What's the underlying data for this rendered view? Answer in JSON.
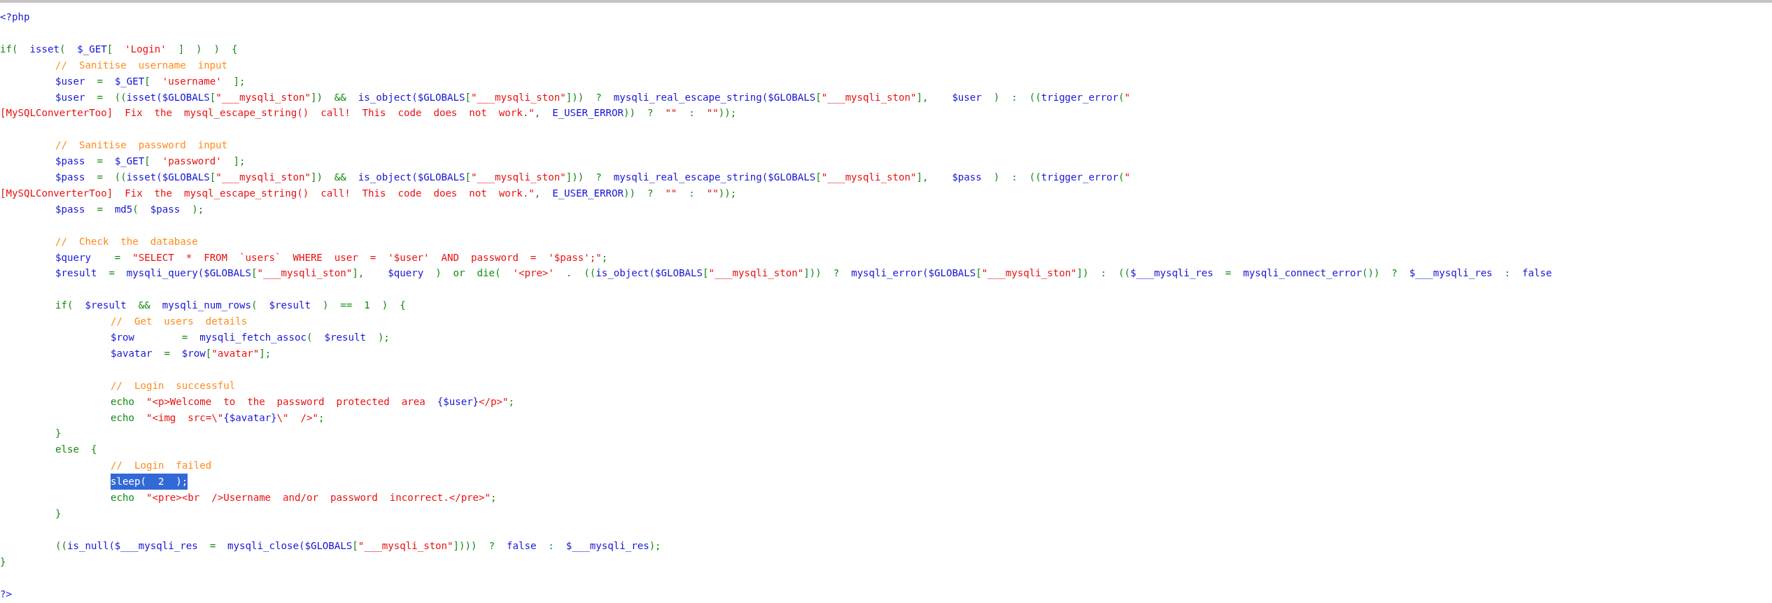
{
  "code_lines": [
    {
      "kind": "code",
      "selected": false,
      "tokens": [
        {
          "text": "<?php",
          "kind": "identifier"
        }
      ]
    },
    {
      "kind": "blank"
    },
    {
      "kind": "code",
      "selected": false,
      "tokens": [
        {
          "text": "if(  ",
          "kind": "operator"
        },
        {
          "text": "isset",
          "kind": "identifier"
        },
        {
          "text": "(  ",
          "kind": "operator"
        },
        {
          "text": "$_GET",
          "kind": "identifier"
        },
        {
          "text": "[  ",
          "kind": "operator"
        },
        {
          "text": "'Login'",
          "kind": "string"
        },
        {
          "text": "  ]  )  )  {",
          "kind": "operator"
        }
      ],
      "children": [
        {
          "kind": "code",
          "selected": false,
          "tokens": [
            {
              "text": "//  Sanitise  username  input",
              "kind": "comment"
            }
          ]
        },
        {
          "kind": "code",
          "selected": false,
          "tokens": [
            {
              "text": "$user  ",
              "kind": "identifier"
            },
            {
              "text": "=  ",
              "kind": "operator"
            },
            {
              "text": "$_GET",
              "kind": "identifier"
            },
            {
              "text": "[  ",
              "kind": "operator"
            },
            {
              "text": "'username'",
              "kind": "string"
            },
            {
              "text": "  ];",
              "kind": "operator"
            }
          ]
        },
        {
          "kind": "code",
          "selected": false,
          "tokens": [
            {
              "text": "$user  ",
              "kind": "identifier"
            },
            {
              "text": "=  ((",
              "kind": "operator"
            },
            {
              "text": "isset($GLOBALS",
              "kind": "identifier"
            },
            {
              "text": "[",
              "kind": "operator"
            },
            {
              "text": "\"___mysqli_ston\"",
              "kind": "string"
            },
            {
              "text": "])  &&  ",
              "kind": "operator"
            },
            {
              "text": "is_object($GLOBALS",
              "kind": "identifier"
            },
            {
              "text": "[",
              "kind": "operator"
            },
            {
              "text": "\"___mysqli_ston\"",
              "kind": "string"
            },
            {
              "text": "]))  ?  ",
              "kind": "operator"
            },
            {
              "text": "mysqli_real_escape_string($GLOBALS",
              "kind": "identifier"
            },
            {
              "text": "[",
              "kind": "operator"
            },
            {
              "text": "\"___mysqli_ston\"",
              "kind": "string"
            },
            {
              "text": "],    ",
              "kind": "operator"
            },
            {
              "text": "$user",
              "kind": "identifier"
            },
            {
              "text": "  )  :  ((",
              "kind": "operator"
            },
            {
              "text": "trigger_error",
              "kind": "identifier"
            },
            {
              "text": "(",
              "kind": "operator"
            },
            {
              "text": "\"",
              "kind": "string"
            }
          ],
          "continuation": [
            {
              "text": "[MySQLConverterToo]  Fix  the  mysql_escape_string()  call!  This  code  does  not  work.\"",
              "kind": "string"
            },
            {
              "text": ",  ",
              "kind": "operator"
            },
            {
              "text": "E_USER_ERROR",
              "kind": "identifier"
            },
            {
              "text": "))  ?  ",
              "kind": "operator"
            },
            {
              "text": "\"\"",
              "kind": "string"
            },
            {
              "text": "  :  ",
              "kind": "operator"
            },
            {
              "text": "\"\"",
              "kind": "string"
            },
            {
              "text": "));",
              "kind": "operator"
            }
          ]
        },
        {
          "kind": "blank"
        },
        {
          "kind": "code",
          "selected": false,
          "tokens": [
            {
              "text": "//  Sanitise  password  input",
              "kind": "comment"
            }
          ]
        },
        {
          "kind": "code",
          "selected": false,
          "tokens": [
            {
              "text": "$pass  ",
              "kind": "identifier"
            },
            {
              "text": "=  ",
              "kind": "operator"
            },
            {
              "text": "$_GET",
              "kind": "identifier"
            },
            {
              "text": "[  ",
              "kind": "operator"
            },
            {
              "text": "'password'",
              "kind": "string"
            },
            {
              "text": "  ];",
              "kind": "operator"
            }
          ]
        },
        {
          "kind": "code",
          "selected": false,
          "tokens": [
            {
              "text": "$pass  ",
              "kind": "identifier"
            },
            {
              "text": "=  ((",
              "kind": "operator"
            },
            {
              "text": "isset($GLOBALS",
              "kind": "identifier"
            },
            {
              "text": "[",
              "kind": "operator"
            },
            {
              "text": "\"___mysqli_ston\"",
              "kind": "string"
            },
            {
              "text": "])  &&  ",
              "kind": "operator"
            },
            {
              "text": "is_object($GLOBALS",
              "kind": "identifier"
            },
            {
              "text": "[",
              "kind": "operator"
            },
            {
              "text": "\"___mysqli_ston\"",
              "kind": "string"
            },
            {
              "text": "]))  ?  ",
              "kind": "operator"
            },
            {
              "text": "mysqli_real_escape_string($GLOBALS",
              "kind": "identifier"
            },
            {
              "text": "[",
              "kind": "operator"
            },
            {
              "text": "\"___mysqli_ston\"",
              "kind": "string"
            },
            {
              "text": "],    ",
              "kind": "operator"
            },
            {
              "text": "$pass",
              "kind": "identifier"
            },
            {
              "text": "  )  :  ((",
              "kind": "operator"
            },
            {
              "text": "trigger_error",
              "kind": "identifier"
            },
            {
              "text": "(",
              "kind": "operator"
            },
            {
              "text": "\"",
              "kind": "string"
            }
          ],
          "continuation": [
            {
              "text": "[MySQLConverterToo]  Fix  the  mysql_escape_string()  call!  This  code  does  not  work.\"",
              "kind": "string"
            },
            {
              "text": ",  ",
              "kind": "operator"
            },
            {
              "text": "E_USER_ERROR",
              "kind": "identifier"
            },
            {
              "text": "))  ?  ",
              "kind": "operator"
            },
            {
              "text": "\"\"",
              "kind": "string"
            },
            {
              "text": "  :  ",
              "kind": "operator"
            },
            {
              "text": "\"\"",
              "kind": "string"
            },
            {
              "text": "));",
              "kind": "operator"
            }
          ]
        },
        {
          "kind": "code",
          "selected": false,
          "tokens": [
            {
              "text": "$pass  ",
              "kind": "identifier"
            },
            {
              "text": "=  ",
              "kind": "operator"
            },
            {
              "text": "md5",
              "kind": "identifier"
            },
            {
              "text": "(  ",
              "kind": "operator"
            },
            {
              "text": "$pass",
              "kind": "identifier"
            },
            {
              "text": "  );",
              "kind": "operator"
            }
          ]
        },
        {
          "kind": "blank"
        },
        {
          "kind": "code",
          "selected": false,
          "tokens": [
            {
              "text": "//  Check  the  database",
              "kind": "comment"
            }
          ]
        },
        {
          "kind": "code",
          "selected": false,
          "tokens": [
            {
              "text": "$query    ",
              "kind": "identifier"
            },
            {
              "text": "=  ",
              "kind": "operator"
            },
            {
              "text": "\"SELECT  *  FROM  `users`  WHERE  user  =  '$user'  AND  password  =  '$pass';\"",
              "kind": "string"
            },
            {
              "text": ";",
              "kind": "operator"
            }
          ]
        },
        {
          "kind": "code",
          "selected": false,
          "tokens": [
            {
              "text": "$result  ",
              "kind": "identifier"
            },
            {
              "text": "=  ",
              "kind": "operator"
            },
            {
              "text": "mysqli_query($GLOBALS",
              "kind": "identifier"
            },
            {
              "text": "[",
              "kind": "operator"
            },
            {
              "text": "\"___mysqli_ston\"",
              "kind": "string"
            },
            {
              "text": "],    ",
              "kind": "operator"
            },
            {
              "text": "$query",
              "kind": "identifier"
            },
            {
              "text": "  )  or  die(  ",
              "kind": "operator"
            },
            {
              "text": "'<pre>'",
              "kind": "string"
            },
            {
              "text": "  .  ((",
              "kind": "operator"
            },
            {
              "text": "is_object($GLOBALS",
              "kind": "identifier"
            },
            {
              "text": "[",
              "kind": "operator"
            },
            {
              "text": "\"___mysqli_ston\"",
              "kind": "string"
            },
            {
              "text": "]))  ?  ",
              "kind": "operator"
            },
            {
              "text": "mysqli_error($GLOBALS",
              "kind": "identifier"
            },
            {
              "text": "[",
              "kind": "operator"
            },
            {
              "text": "\"___mysqli_ston\"",
              "kind": "string"
            },
            {
              "text": "])  :  ((",
              "kind": "operator"
            },
            {
              "text": "$___mysqli_res",
              "kind": "identifier"
            },
            {
              "text": "  =  ",
              "kind": "operator"
            },
            {
              "text": "mysqli_connect_error",
              "kind": "identifier"
            },
            {
              "text": "())  ?  ",
              "kind": "operator"
            },
            {
              "text": "$___mysqli_res",
              "kind": "identifier"
            },
            {
              "text": "  :  ",
              "kind": "operator"
            },
            {
              "text": "false",
              "kind": "identifier"
            }
          ]
        },
        {
          "kind": "blank"
        },
        {
          "kind": "code",
          "selected": false,
          "tokens": [
            {
              "text": "if(  ",
              "kind": "operator"
            },
            {
              "text": "$result",
              "kind": "identifier"
            },
            {
              "text": "  &&  ",
              "kind": "operator"
            },
            {
              "text": "mysqli_num_rows",
              "kind": "identifier"
            },
            {
              "text": "(  ",
              "kind": "operator"
            },
            {
              "text": "$result",
              "kind": "identifier"
            },
            {
              "text": "  )  ==  1  )  {",
              "kind": "operator"
            }
          ],
          "children": [
            {
              "kind": "code",
              "selected": false,
              "tokens": [
                {
                  "text": "//  Get  users  details",
                  "kind": "comment"
                }
              ]
            },
            {
              "kind": "code",
              "selected": false,
              "tokens": [
                {
                  "text": "$row        ",
                  "kind": "identifier"
                },
                {
                  "text": "=  ",
                  "kind": "operator"
                },
                {
                  "text": "mysqli_fetch_assoc",
                  "kind": "identifier"
                },
                {
                  "text": "(  ",
                  "kind": "operator"
                },
                {
                  "text": "$result",
                  "kind": "identifier"
                },
                {
                  "text": "  );",
                  "kind": "operator"
                }
              ]
            },
            {
              "kind": "code",
              "selected": false,
              "tokens": [
                {
                  "text": "$avatar  ",
                  "kind": "identifier"
                },
                {
                  "text": "=  ",
                  "kind": "operator"
                },
                {
                  "text": "$row",
                  "kind": "identifier"
                },
                {
                  "text": "[",
                  "kind": "operator"
                },
                {
                  "text": "\"avatar\"",
                  "kind": "string"
                },
                {
                  "text": "];",
                  "kind": "operator"
                }
              ]
            },
            {
              "kind": "blank"
            },
            {
              "kind": "code",
              "selected": false,
              "tokens": [
                {
                  "text": "//  Login  successful",
                  "kind": "comment"
                }
              ]
            },
            {
              "kind": "code",
              "selected": false,
              "tokens": [
                {
                  "text": "echo  ",
                  "kind": "operator"
                },
                {
                  "text": "\"<p>Welcome  to  the  password  protected  area  ",
                  "kind": "string"
                },
                {
                  "text": "{$user}",
                  "kind": "identifier"
                },
                {
                  "text": "</p>\"",
                  "kind": "string"
                },
                {
                  "text": ";",
                  "kind": "operator"
                }
              ]
            },
            {
              "kind": "code",
              "selected": false,
              "tokens": [
                {
                  "text": "echo  ",
                  "kind": "operator"
                },
                {
                  "text": "\"<img  src=\\\"",
                  "kind": "string"
                },
                {
                  "text": "{$avatar}",
                  "kind": "identifier"
                },
                {
                  "text": "\\\"  />\"",
                  "kind": "string"
                },
                {
                  "text": ";",
                  "kind": "operator"
                }
              ]
            }
          ]
        },
        {
          "kind": "code",
          "selected": false,
          "tokens": [
            {
              "text": "}",
              "kind": "operator"
            }
          ]
        },
        {
          "kind": "code",
          "selected": false,
          "tokens": [
            {
              "text": "else  {",
              "kind": "operator"
            }
          ],
          "children": [
            {
              "kind": "code",
              "selected": false,
              "tokens": [
                {
                  "text": "//  Login  failed",
                  "kind": "comment"
                }
              ]
            },
            {
              "kind": "code",
              "selected": true,
              "tokens": [
                {
                  "text": "sleep(  2  );"
                }
              ]
            },
            {
              "kind": "code",
              "selected": false,
              "tokens": [
                {
                  "text": "echo  ",
                  "kind": "operator"
                },
                {
                  "text": "\"<pre><br  />Username  and/or  password  incorrect.</pre>\"",
                  "kind": "string"
                },
                {
                  "text": ";",
                  "kind": "operator"
                }
              ]
            }
          ]
        },
        {
          "kind": "code",
          "selected": false,
          "tokens": [
            {
              "text": "}",
              "kind": "operator"
            }
          ]
        },
        {
          "kind": "blank"
        },
        {
          "kind": "code",
          "selected": false,
          "tokens": [
            {
              "text": "((",
              "kind": "operator"
            },
            {
              "text": "is_null($___mysqli_res",
              "kind": "identifier"
            },
            {
              "text": "  =  ",
              "kind": "operator"
            },
            {
              "text": "mysqli_close($GLOBALS",
              "kind": "identifier"
            },
            {
              "text": "[",
              "kind": "operator"
            },
            {
              "text": "\"___mysqli_ston\"",
              "kind": "string"
            },
            {
              "text": "])))  ?  ",
              "kind": "operator"
            },
            {
              "text": "false",
              "kind": "identifier"
            },
            {
              "text": "  :  ",
              "kind": "operator"
            },
            {
              "text": "$___mysqli_res",
              "kind": "identifier"
            },
            {
              "text": ");",
              "kind": "operator"
            }
          ]
        }
      ]
    },
    {
      "kind": "code",
      "selected": false,
      "tokens": [
        {
          "text": "}",
          "kind": "operator"
        }
      ]
    },
    {
      "kind": "blank"
    },
    {
      "kind": "code",
      "selected": false,
      "tokens": [
        {
          "text": "?>",
          "kind": "identifier"
        }
      ]
    }
  ]
}
